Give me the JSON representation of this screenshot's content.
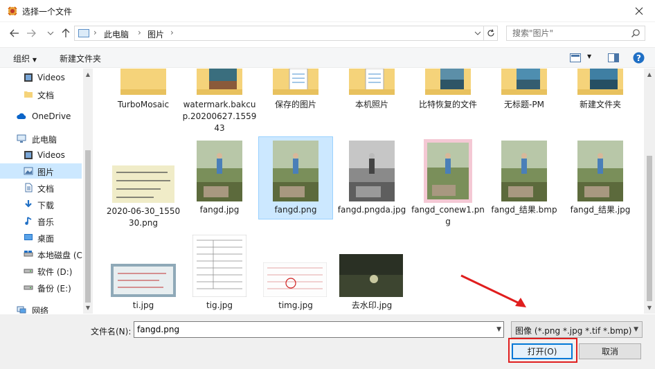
{
  "window": {
    "title": "选择一个文件"
  },
  "address": {
    "crumbs": [
      "此电脑",
      "图片"
    ]
  },
  "search": {
    "placeholder": "搜索\"图片\""
  },
  "toolbar": {
    "organize": "组织",
    "new_folder": "新建文件夹"
  },
  "sidebar": {
    "items": [
      {
        "label": "Videos",
        "icon": "video-icon"
      },
      {
        "label": "文档",
        "icon": "folder-icon"
      },
      {
        "label": "OneDrive",
        "icon": "cloud-icon"
      },
      {
        "label": "此电脑",
        "icon": "computer-icon"
      },
      {
        "label": "Videos",
        "icon": "video-icon"
      },
      {
        "label": "图片",
        "icon": "pictures-icon",
        "selected": true
      },
      {
        "label": "文档",
        "icon": "document-icon"
      },
      {
        "label": "下载",
        "icon": "download-icon"
      },
      {
        "label": "音乐",
        "icon": "music-icon"
      },
      {
        "label": "桌面",
        "icon": "desktop-icon"
      },
      {
        "label": "本地磁盘 (C",
        "icon": "drive-icon"
      },
      {
        "label": "软件 (D:)",
        "icon": "drive-icon"
      },
      {
        "label": "备份 (E:)",
        "icon": "drive-icon"
      },
      {
        "label": "网络",
        "icon": "network-icon"
      }
    ]
  },
  "files": [
    {
      "name": "TurboMosaic",
      "kind": "folder"
    },
    {
      "name": "watermark.bakcup.20200627.155943",
      "kind": "folder-photo"
    },
    {
      "name": "保存的图片",
      "kind": "folder-docs"
    },
    {
      "name": "本机照片",
      "kind": "folder-docs"
    },
    {
      "name": "比特恢复的文件",
      "kind": "folder-photo"
    },
    {
      "name": "无标题-PM",
      "kind": "folder-photo"
    },
    {
      "name": "新建文件夹",
      "kind": "folder-photo"
    },
    {
      "name": "2020-06-30_155030.png",
      "kind": "formula"
    },
    {
      "name": "fangd.jpg",
      "kind": "photo"
    },
    {
      "name": "fangd.png",
      "kind": "photo",
      "selected": true
    },
    {
      "name": "fangd.pngda.jpg",
      "kind": "photo-gray"
    },
    {
      "name": "fangd_conew1.png",
      "kind": "photo-frame"
    },
    {
      "name": "fangd_结果.bmp",
      "kind": "photo"
    },
    {
      "name": "fangd_结果.jpg",
      "kind": "photo"
    },
    {
      "name": "ti.jpg",
      "kind": "ticket"
    },
    {
      "name": "tig.jpg",
      "kind": "form"
    },
    {
      "name": "timg.jpg",
      "kind": "invoice"
    },
    {
      "name": "去水印.jpg",
      "kind": "dark"
    }
  ],
  "bottom": {
    "filename_label": "文件名(N):",
    "filename_value": "fangd.png",
    "filetype": "图像 (*.png *.jpg *.tif *.bmp)",
    "open": "打开(O)",
    "cancel": "取消"
  },
  "colors": {
    "selection": "#cce8ff",
    "highlight_box": "#e01e1e",
    "accent": "#0078d7"
  }
}
